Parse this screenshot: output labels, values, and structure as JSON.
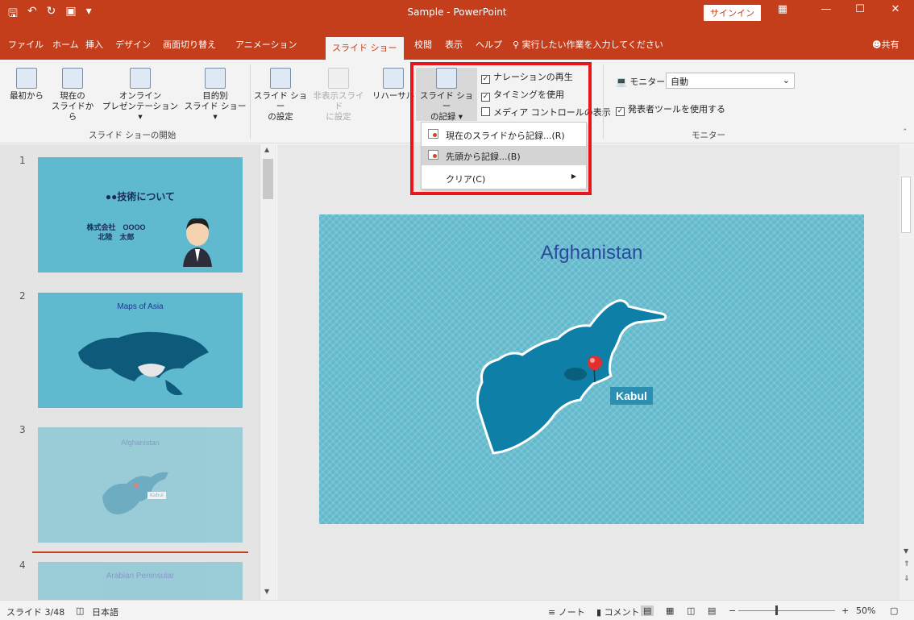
{
  "window": {
    "title": "Sample - PowerPoint",
    "signin": "サインイン",
    "qat_icons": [
      "save-icon",
      "undo-icon",
      "redo-icon",
      "start-from-beginning-icon"
    ]
  },
  "tabs": [
    "ファイル",
    "ホーム",
    "挿入",
    "デザイン",
    "画面切り替え",
    "アニメーション",
    "スライド ショー",
    "校閲",
    "表示",
    "ヘルプ"
  ],
  "tell_me": "実行したい作業を入力してください",
  "share": "共有",
  "ribbon": {
    "from_beginning": "最初から",
    "from_current_1": "現在の",
    "from_current_2": "スライドから",
    "online_1": "オンライン",
    "online_2": "プレゼンテーション ▾",
    "custom_1": "目的別",
    "custom_2": "スライド ショー ▾",
    "group_start": "スライド ショーの開始",
    "setup_1": "スライド ショー",
    "setup_2": "の設定",
    "hide_1": "非表示スライド",
    "hide_2": "に設定",
    "rehearse": "リハーサル",
    "record_1": "スライド ショー",
    "record_2": "の記録 ▾",
    "chk_narration": "ナレーションの再生",
    "chk_timing": "タイミングを使用",
    "chk_media": "メディア コントロールの表示",
    "monitor_label": "モニター:",
    "monitor_value": "自動",
    "chk_presenter": "発表者ツールを使用する",
    "group_monitor": "モニター"
  },
  "menu": {
    "items": [
      "現在のスライドから記録...(R)",
      "先頭から記録...(B)",
      "クリア(C)"
    ],
    "highlighted_index": 1
  },
  "slides": [
    {
      "num": "1",
      "title": "●●技術について",
      "company": "株式会社　OOOO",
      "person": "北陸　太郎"
    },
    {
      "num": "2",
      "title": "Maps of Asia"
    },
    {
      "num": "3",
      "title": "Afghanistan",
      "label": "Kabul"
    },
    {
      "num": "4",
      "title": "Arabian Peninsular"
    }
  ],
  "current_slide": {
    "title": "Afghanistan",
    "label": "Kabul"
  },
  "status": {
    "slide": "スライド 3/48",
    "language": "日本語",
    "notes": "ノート",
    "comments": "コメント",
    "zoom": "50%"
  },
  "colors": {
    "brand": "#c43e1c",
    "slide_bg": "#62b9cc",
    "map": "#0e7fa6",
    "pin": "#e03030"
  }
}
